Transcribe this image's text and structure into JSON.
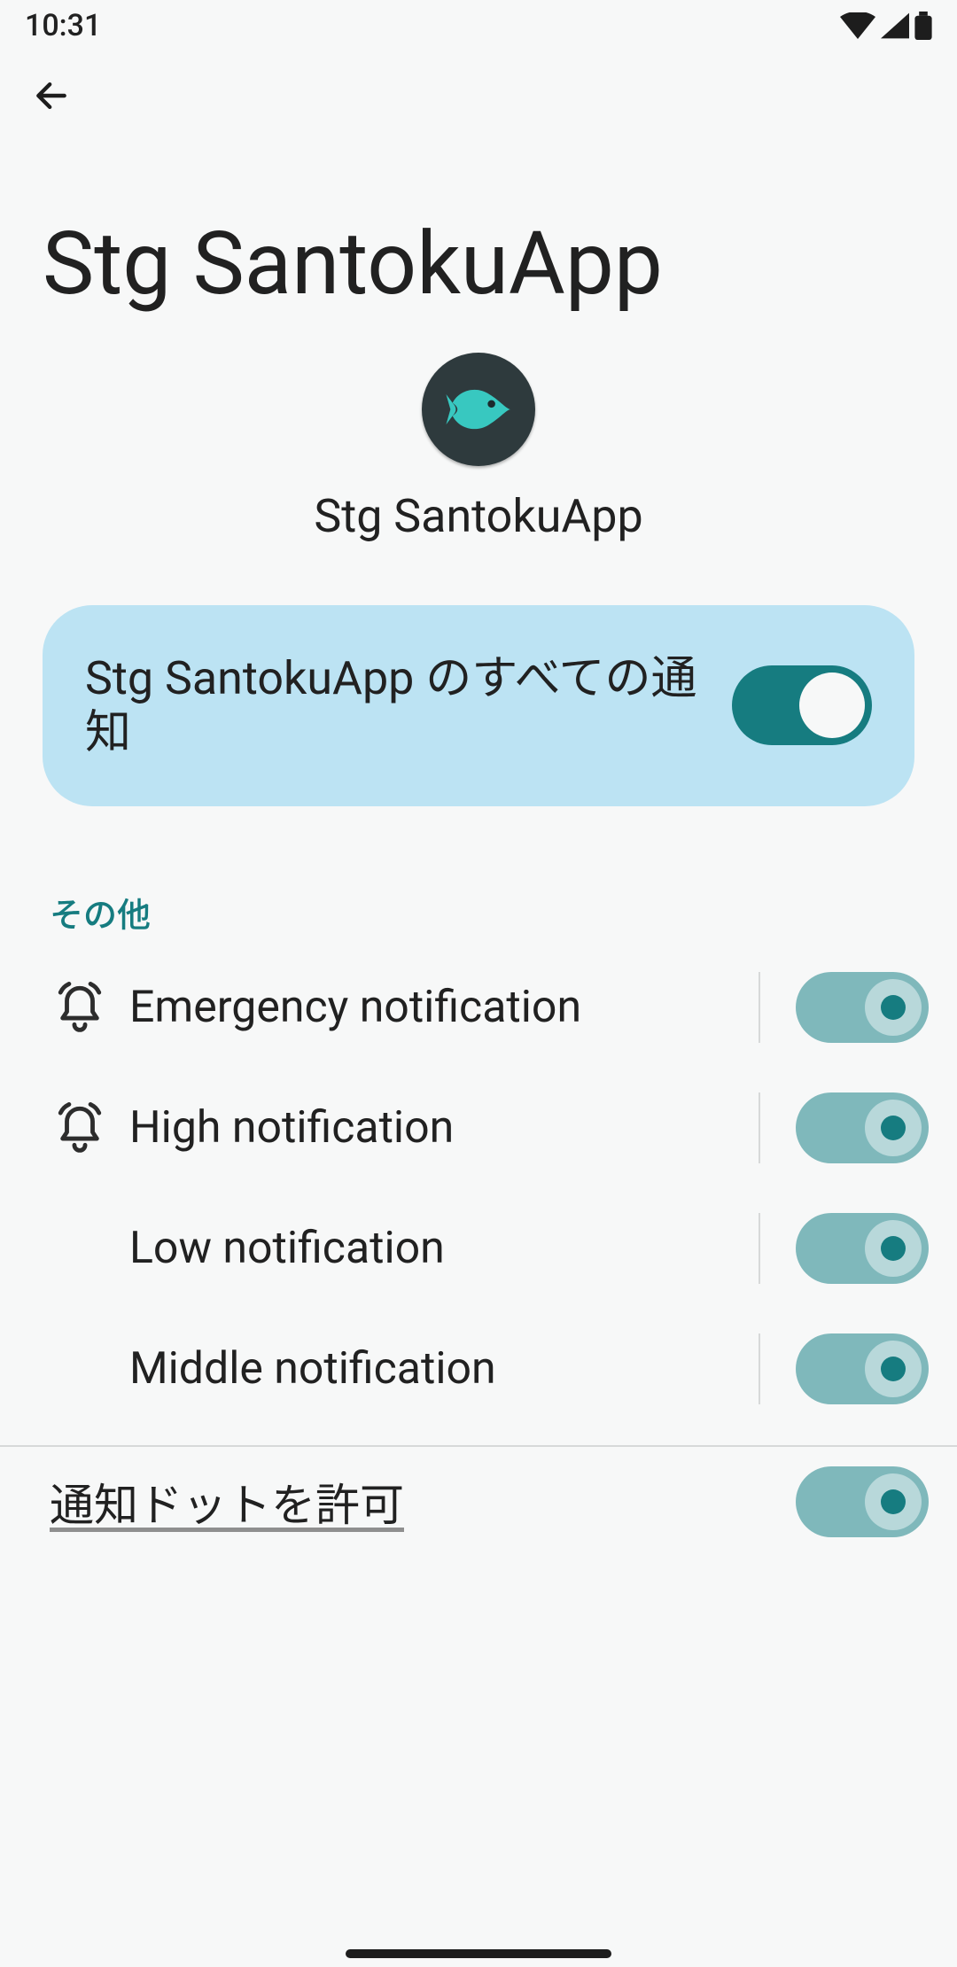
{
  "statusbar": {
    "time": "10:31"
  },
  "page": {
    "title": "Stg SantokuApp"
  },
  "app": {
    "name": "Stg SantokuApp",
    "icon": "fish-icon"
  },
  "master_toggle": {
    "label": "Stg SantokuApp のすべての通知",
    "on": true
  },
  "section_other": {
    "label": "その他"
  },
  "channels": [
    {
      "label": "Emergency notification",
      "icon": "bell-ring-icon",
      "on": true
    },
    {
      "label": "High notification",
      "icon": "bell-ring-icon",
      "on": true
    },
    {
      "label": "Low notification",
      "icon": "",
      "on": true
    },
    {
      "label": "Middle notification",
      "icon": "",
      "on": true
    }
  ],
  "dot": {
    "label": "通知ドットを許可",
    "on": true
  },
  "colors": {
    "accent": "#167c80",
    "card": "#bce3f3"
  }
}
